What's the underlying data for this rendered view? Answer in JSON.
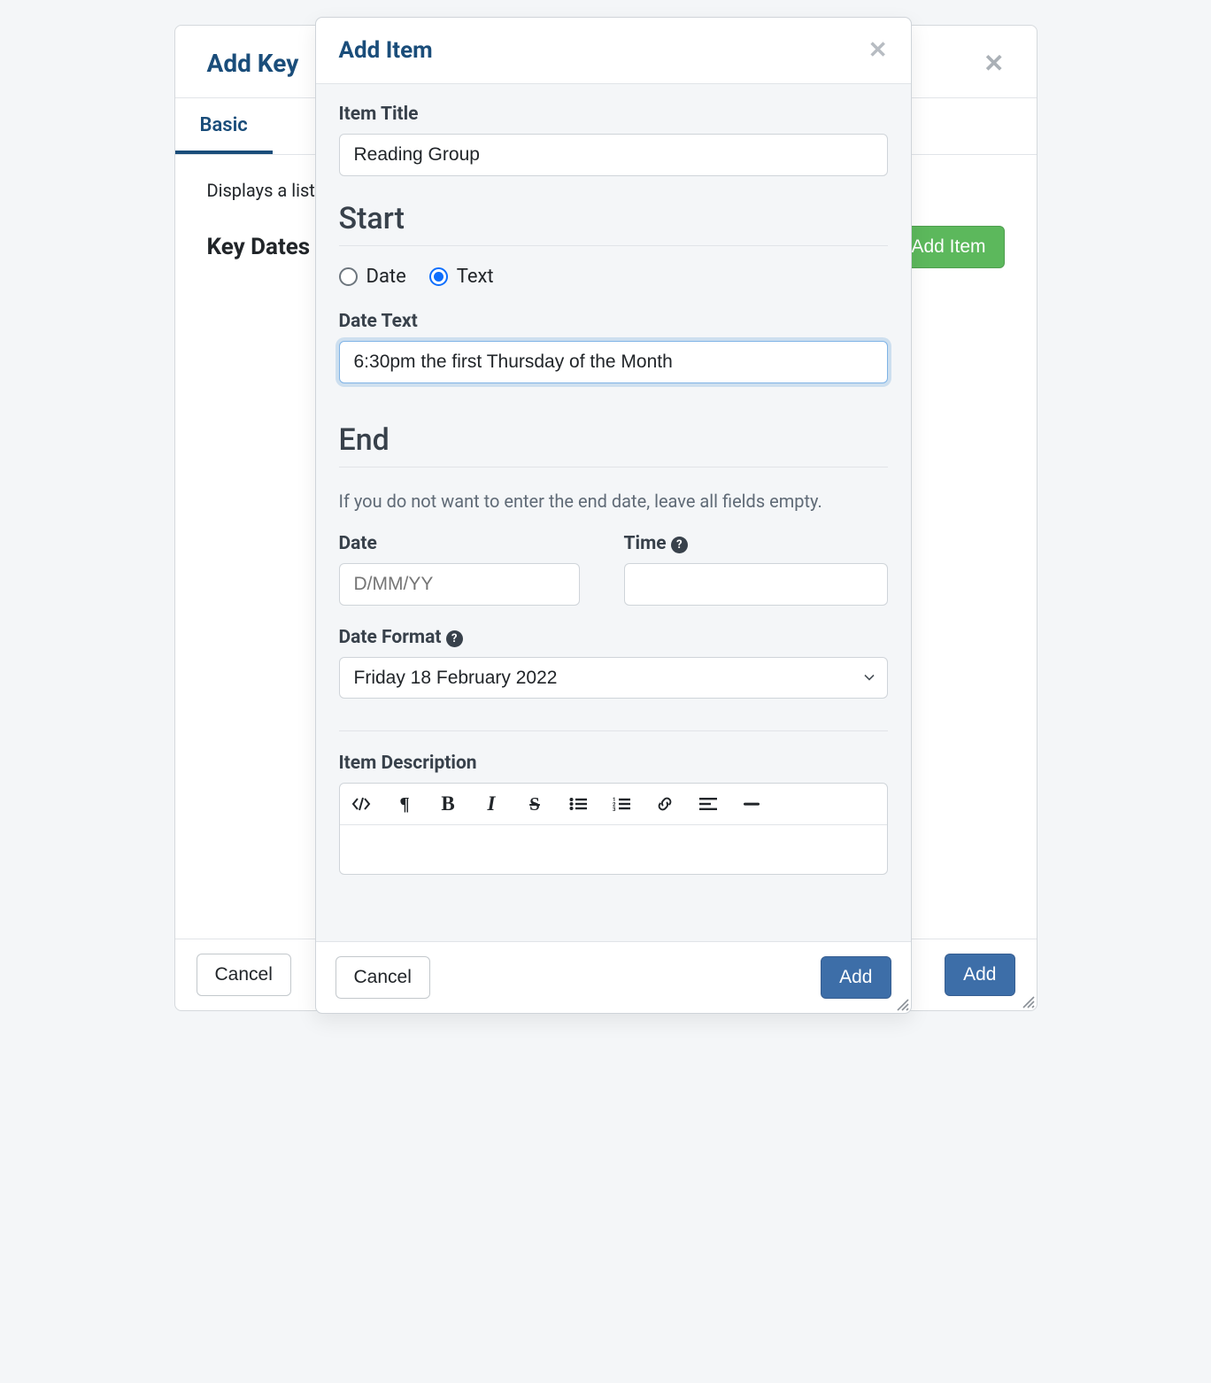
{
  "background": {
    "title": "Add Key",
    "tab": "Basic",
    "helptext": "Displays a list",
    "section_label": "Key Dates",
    "add_item_btn": "Add Item",
    "cancel_btn": "Cancel",
    "add_btn": "Add"
  },
  "modal": {
    "title": "Add Item",
    "item_title_label": "Item Title",
    "item_title_value": "Reading Group",
    "start_heading": "Start",
    "radio_date": "Date",
    "radio_text": "Text",
    "date_text_label": "Date Text",
    "date_text_value": "6:30pm the first Thursday of the Month",
    "end_heading": "End",
    "end_help": "If you do not want to enter the end date, leave all fields empty.",
    "end_date_label": "Date",
    "end_date_placeholder": "D/MM/YY",
    "end_time_label": "Time",
    "date_format_label": "Date Format",
    "date_format_value": "Friday 18 February 2022",
    "item_description_label": "Item Description",
    "cancel_btn": "Cancel",
    "add_btn": "Add"
  }
}
